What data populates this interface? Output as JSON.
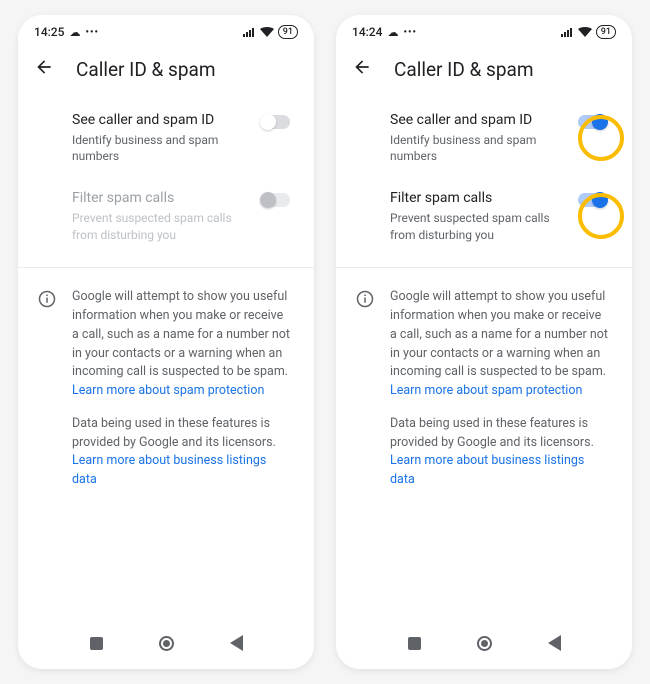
{
  "screens": {
    "left": {
      "status": {
        "time": "14:25",
        "battery": "91"
      },
      "header": {
        "title": "Caller ID & spam"
      },
      "settings": {
        "callerID": {
          "title": "See caller and spam ID",
          "subtitle": "Identify business and spam numbers"
        },
        "filterSpam": {
          "title": "Filter spam calls",
          "subtitle": "Prevent suspected spam calls from disturbing you"
        }
      }
    },
    "right": {
      "status": {
        "time": "14:24",
        "battery": "91"
      },
      "header": {
        "title": "Caller ID & spam"
      },
      "settings": {
        "callerID": {
          "title": "See caller and spam ID",
          "subtitle": "Identify business and spam numbers"
        },
        "filterSpam": {
          "title": "Filter spam calls",
          "subtitle": "Prevent suspected spam calls from disturbing you"
        }
      }
    }
  },
  "info": {
    "p1_a": "Google will attempt to show you useful information when you make or receive a call, such as a name for a number not in your contacts or a warning when an incoming call is suspected to be spam. ",
    "link1": "Learn more about spam protection",
    "p2_a": "Data being used in these features is provided by Google and its licensors. ",
    "link2": "Learn more about business listings data"
  }
}
